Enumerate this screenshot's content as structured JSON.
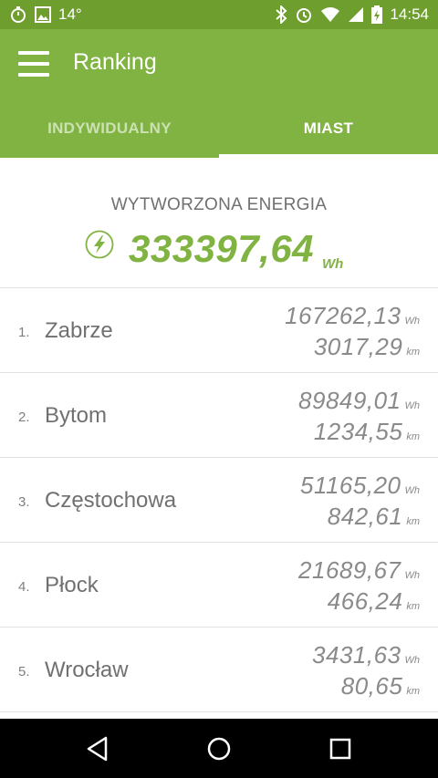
{
  "status_bar": {
    "temperature": "14°",
    "time": "14:54",
    "icons_left": [
      "stopwatch-icon",
      "image-icon"
    ],
    "icons_right": [
      "bluetooth-icon",
      "alarm-icon",
      "wifi-icon",
      "signal-icon",
      "battery-icon"
    ]
  },
  "app_bar": {
    "title": "Ranking",
    "menu_icon": "hamburger-menu-icon"
  },
  "tabs": [
    {
      "label": "INDYWIDUALNY",
      "active": false
    },
    {
      "label": "MIAST",
      "active": true
    }
  ],
  "energy": {
    "label": "WYTWORZONA ENERGIA",
    "value": "333397,64",
    "unit": "Wh",
    "icon": "lightning-bolt-icon"
  },
  "ranking": [
    {
      "rank": "1.",
      "city": "Zabrze",
      "energy": "167262,13",
      "energy_unit": "Wh",
      "distance": "3017,29",
      "distance_unit": "km"
    },
    {
      "rank": "2.",
      "city": "Bytom",
      "energy": "89849,01",
      "energy_unit": "Wh",
      "distance": "1234,55",
      "distance_unit": "km"
    },
    {
      "rank": "3.",
      "city": "Częstochowa",
      "energy": "51165,20",
      "energy_unit": "Wh",
      "distance": "842,61",
      "distance_unit": "km"
    },
    {
      "rank": "4.",
      "city": "Płock",
      "energy": "21689,67",
      "energy_unit": "Wh",
      "distance": "466,24",
      "distance_unit": "km"
    },
    {
      "rank": "5.",
      "city": "Wrocław",
      "energy": "3431,63",
      "energy_unit": "Wh",
      "distance": "80,65",
      "distance_unit": "km"
    }
  ],
  "nav_bar": {
    "buttons": [
      "back-icon",
      "home-icon",
      "recents-icon"
    ]
  },
  "colors": {
    "accent": "#80b341",
    "status_bar": "#6e9e2e",
    "text_gray": "#707070"
  }
}
